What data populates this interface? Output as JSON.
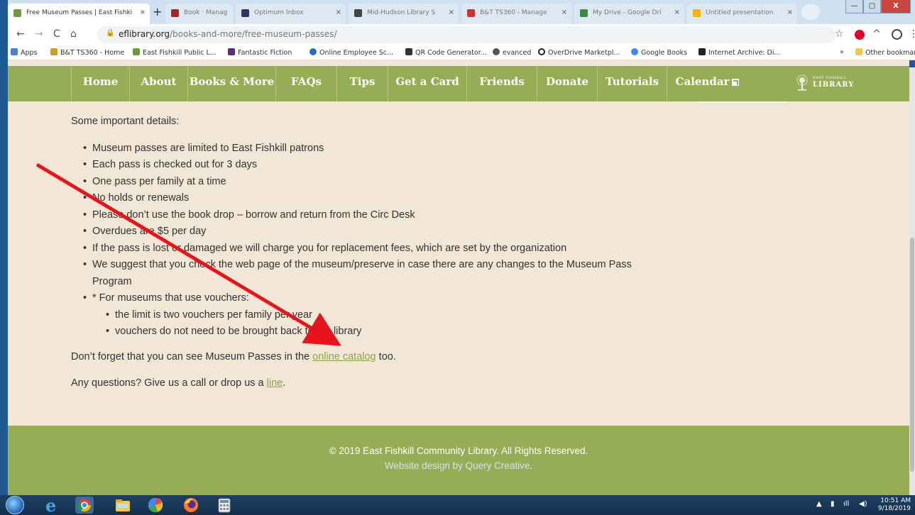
{
  "browser": {
    "tabs": [
      {
        "title": "Free Museum Passes | East Fishki",
        "active": true
      },
      {
        "title": "Book · Manag",
        "active": false
      },
      {
        "title": "Optimum Inbox",
        "active": false
      },
      {
        "title": "Mid-Hudson Library S",
        "active": false
      },
      {
        "title": "B&T TS360 - Manage",
        "active": false
      },
      {
        "title": "My Drive - Google Dri",
        "active": false
      },
      {
        "title": "Untitled presentation",
        "active": false
      }
    ],
    "close_glyph": "×",
    "new_tab_glyph": "+",
    "window_buttons": {
      "minimize": "—",
      "maximize": "▢",
      "close": "X"
    },
    "nav": {
      "back": "←",
      "forward": "→",
      "reload": "C",
      "home": "⌂"
    },
    "url_host": "eflibrary.org",
    "url_path": "/books-and-more/free-museum-passes/",
    "toolbar_icons": [
      "star-icon",
      "pinterest-icon",
      "extension-icon",
      "profile-icon",
      "menu-icon"
    ],
    "bookmarks": [
      {
        "label": "Apps",
        "icon": "apps-grid-icon"
      },
      {
        "label": "B&T TS360 - Home",
        "icon": "bt-icon"
      },
      {
        "label": "East Fishkill Public L...",
        "icon": "tree-icon"
      },
      {
        "label": "Fantastic Fiction",
        "icon": "ff-icon"
      },
      {
        "label": "Online Employee Sc...",
        "icon": "w-icon"
      },
      {
        "label": "QR Code Generator...",
        "icon": "qr-icon"
      },
      {
        "label": "evanced",
        "icon": "globe-icon"
      },
      {
        "label": "OverDrive Marketpl...",
        "icon": "overdrive-icon"
      },
      {
        "label": "Google Books",
        "icon": "google-icon"
      },
      {
        "label": "Internet Archive: Di...",
        "icon": "archive-icon"
      }
    ],
    "bookmarks_more": "»",
    "other_bookmarks": "Other bookmarks"
  },
  "site": {
    "nav": [
      "Home",
      "About",
      "Books & More",
      "FAQs",
      "Tips",
      "Get a Card",
      "Friends",
      "Donate",
      "Tutorials",
      "Calendar"
    ],
    "logo_small": "EAST FISHKILL",
    "logo_big": "LIBRARY"
  },
  "content": {
    "intro": "Some important details:",
    "bullets": [
      "Museum passes are limited to East Fishkill patrons",
      "Each pass is checked out for 3 days",
      "One pass per family at a time",
      "No holds or renewals",
      "Please don’t use the book drop – borrow and return from the Circ Desk",
      "Overdues are $5 per day",
      "If the pass is lost or damaged we will charge you for replacement fees, which are set by the organization",
      "We suggest that you check the web page of the museum/preserve in case there are any changes to the Museum Pass Program",
      "* For museums that use vouchers:"
    ],
    "sub_bullets": [
      "the limit is two vouchers per family per year",
      "vouchers do not need to be brought back to the library"
    ],
    "catalog_before": "Don’t forget that you can see Museum Passes in the ",
    "catalog_link": "online catalog",
    "catalog_after": " too.",
    "questions_before": "Any questions?  Give us a call or drop us a ",
    "questions_link": "line",
    "questions_after": "."
  },
  "footer": {
    "copyright": "© 2019 East Fishkill Community Library. All Rights Reserved.",
    "design": "Website design by Query Creative",
    "design_end": "."
  },
  "taskbar": {
    "apps": [
      "windows-start-icon",
      "internet-explorer-icon",
      "chrome-icon",
      "file-explorer-icon",
      "sync-icon",
      "firefox-icon",
      "calculator-icon"
    ],
    "time": "10:51 AM",
    "date": "9/18/2019"
  },
  "colors": {
    "nav_green": "#97ad55",
    "page_bg": "#f2e6d6",
    "link_green": "#8da344",
    "arrow_red": "#e8141b"
  }
}
